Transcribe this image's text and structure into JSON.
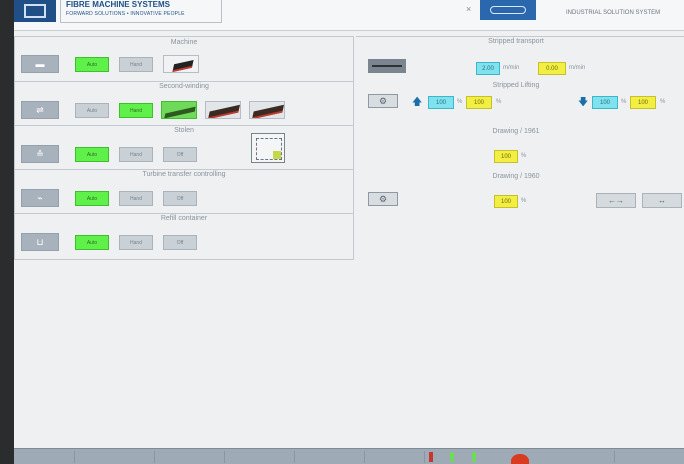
{
  "header": {
    "company": "FIBRE MACHINE SYSTEMS",
    "tagline": "FORWARD SOLUTIONS • INNOVATIVE PEOPLE",
    "close_glyph": "×",
    "right_text": "INDUSTRIAL SOLUTION SYSTEM"
  },
  "left": {
    "sections": [
      {
        "title": "Machine",
        "buttons": [
          "Auto",
          "Hand"
        ],
        "active": "Auto"
      },
      {
        "title": "Second-winding",
        "buttons": [
          "Auto",
          "Hand"
        ],
        "active": "Hand"
      },
      {
        "title": "Stolen",
        "buttons": [
          "Auto",
          "Hand",
          "Off"
        ],
        "active": "Auto"
      },
      {
        "title": "Turbine transfer controlling",
        "buttons": [
          "Auto",
          "Hand",
          "Off"
        ],
        "active": "Auto"
      },
      {
        "title": "Refill container",
        "buttons": [
          "Auto",
          "Hand",
          "Off"
        ],
        "active": "Auto"
      }
    ]
  },
  "right": {
    "transport": {
      "title": "Stripped transport",
      "value_a": "2.00",
      "unit_a": "m/min",
      "value_b": "0.00",
      "unit_b": "m/min"
    },
    "lifting": {
      "title": "Stripped Lifting",
      "up_a": "100",
      "up_b": "100",
      "down_a": "100",
      "down_b": "100",
      "unit": "%"
    },
    "drawing1": {
      "title": "Drawing / 1961",
      "value": "100",
      "unit": "%"
    },
    "drawing2": {
      "title": "Drawing / 1960",
      "value": "100",
      "unit": "%"
    },
    "buttons": {
      "left": "←→",
      "right": "↔"
    }
  },
  "colors": {
    "active_green": "#5ff04a",
    "cyan": "#7fe2ee",
    "yellow": "#f2ef42"
  }
}
